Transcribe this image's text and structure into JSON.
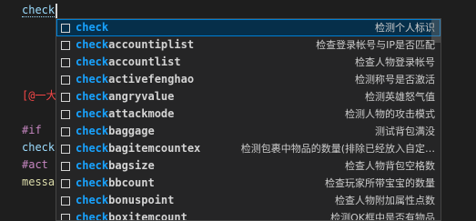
{
  "editor": {
    "typed_text": "check",
    "lines": [
      {
        "parts": [
          {
            "text": "[@一大",
            "cls": "c-red"
          }
        ]
      },
      {
        "parts": [
          {
            "text": "#if",
            "cls": "c-kw"
          }
        ]
      },
      {
        "parts": [
          {
            "text": "check",
            "cls": "c-var"
          }
        ]
      },
      {
        "parts": [
          {
            "text": "#act",
            "cls": "c-kw"
          }
        ]
      },
      {
        "parts": [
          {
            "text": "messa",
            "cls": "c-fn"
          }
        ]
      }
    ]
  },
  "suggestions": {
    "match": "check",
    "selected_index": 0,
    "items": [
      {
        "label": "check",
        "rest": "",
        "detail": "检测个人标识"
      },
      {
        "label": "check",
        "rest": "accountiplist",
        "detail": "检查登录帐号与IP是否匹配"
      },
      {
        "label": "check",
        "rest": "accountlist",
        "detail": "检查人物登录帐号"
      },
      {
        "label": "check",
        "rest": "activefenghao",
        "detail": "检测称号是否激活"
      },
      {
        "label": "check",
        "rest": "angryvalue",
        "detail": "检测英雄怒气值"
      },
      {
        "label": "check",
        "rest": "attackmode",
        "detail": "检测人物的攻击模式"
      },
      {
        "label": "check",
        "rest": "baggage",
        "detail": "测试背包满没"
      },
      {
        "label": "check",
        "rest": "bagitemcountex",
        "detail": "检测包裹中物品的数量(排除已经放入自定…"
      },
      {
        "label": "check",
        "rest": "bagsize",
        "detail": "检查人物背包空格数"
      },
      {
        "label": "check",
        "rest": "bbcount",
        "detail": "检查玩家所带宝宝的数量"
      },
      {
        "label": "check",
        "rest": "bonuspoint",
        "detail": "检查人物附加属性点数"
      },
      {
        "label": "check",
        "rest": "boxitemcount",
        "detail": "检测OK框中是否有物品"
      }
    ]
  },
  "colors": {
    "background": "#1e1e1e",
    "widget_bg": "#252526",
    "match_highlight": "#18a3ff",
    "selection_bg": "#062f4a",
    "selection_border": "#007fd4"
  }
}
